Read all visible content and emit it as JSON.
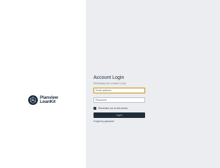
{
  "brand": {
    "name_line1": "Planview",
    "name_line2": "LeanKit",
    "logo_icon": "planview-leankit-logo-icon",
    "colors": {
      "dark": "#1b2a3b",
      "accent_border": "#c8a23a"
    }
  },
  "login": {
    "title": "Account Login",
    "subtitle": "PERSONALIZE.LEANKIT.COM",
    "email_placeholder": "Email address",
    "password_placeholder": "Password",
    "remember_label": "Remember me on this device",
    "remember_checked": true,
    "button_label": "Log in",
    "forgot_link": "Forgot my password"
  }
}
